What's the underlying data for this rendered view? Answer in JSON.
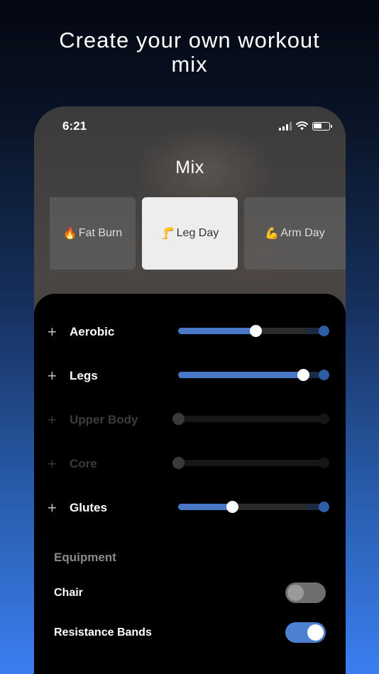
{
  "headline": "Create your own workout mix",
  "status_bar": {
    "time": "6:21"
  },
  "screen": {
    "title": "Mix"
  },
  "mix_cards": [
    {
      "emoji": "🔥",
      "label": "Fat Burn",
      "selected": false
    },
    {
      "emoji": "🦵",
      "label": "Leg Day",
      "selected": true
    },
    {
      "emoji": "💪",
      "label": "Arm Day",
      "selected": false
    }
  ],
  "sliders": [
    {
      "label": "Aerobic",
      "value": 0.52,
      "enabled": true
    },
    {
      "label": "Legs",
      "value": 0.84,
      "enabled": true
    },
    {
      "label": "Upper Body",
      "value": 0.0,
      "enabled": false
    },
    {
      "label": "Core",
      "value": 0.0,
      "enabled": false
    },
    {
      "label": "Glutes",
      "value": 0.36,
      "enabled": true
    }
  ],
  "equipment": {
    "title": "Equipment",
    "items": [
      {
        "label": "Chair",
        "on": false
      },
      {
        "label": "Resistance Bands",
        "on": true
      }
    ]
  },
  "colors": {
    "accent": "#4a78c8",
    "toggle_on": "#4d80d1"
  }
}
